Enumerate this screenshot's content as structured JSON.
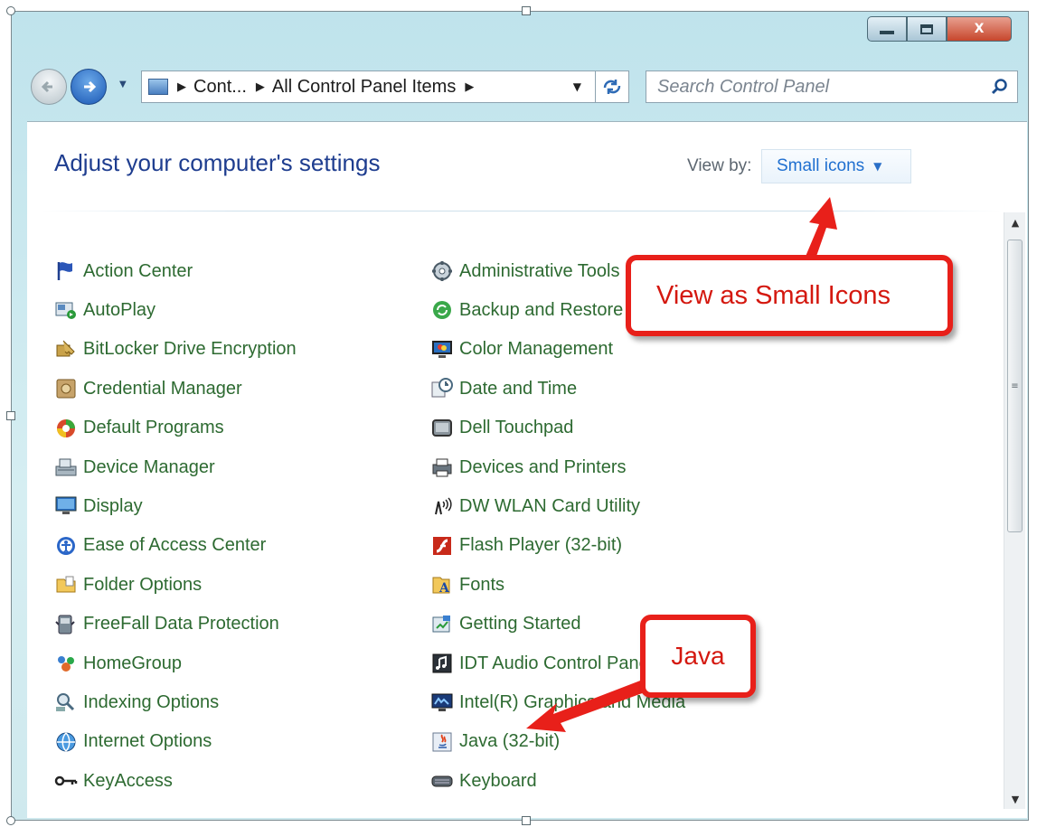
{
  "window": {
    "caption_buttons": {
      "minimize_icon": "minimize-icon",
      "maximize_icon": "maximize-icon",
      "close_glyph": "X"
    }
  },
  "address_bar": {
    "crumbs": [
      "Cont...",
      "All Control Panel Items"
    ],
    "search_placeholder": "Search Control Panel"
  },
  "header": {
    "title": "Adjust your computer's settings",
    "view_by_label": "View by:",
    "view_by_value": "Small icons"
  },
  "items_left": [
    {
      "label": "Action Center",
      "icon": "flag-icon"
    },
    {
      "label": "AutoPlay",
      "icon": "autoplay-icon"
    },
    {
      "label": "BitLocker Drive Encryption",
      "icon": "bitlocker-key-icon"
    },
    {
      "label": "Credential Manager",
      "icon": "vault-icon"
    },
    {
      "label": "Default Programs",
      "icon": "default-programs-icon"
    },
    {
      "label": "Device Manager",
      "icon": "device-manager-icon"
    },
    {
      "label": "Display",
      "icon": "monitor-icon"
    },
    {
      "label": "Ease of Access Center",
      "icon": "ease-of-access-icon"
    },
    {
      "label": "Folder Options",
      "icon": "folder-icon"
    },
    {
      "label": "FreeFall Data Protection",
      "icon": "freefall-icon"
    },
    {
      "label": "HomeGroup",
      "icon": "homegroup-icon"
    },
    {
      "label": "Indexing Options",
      "icon": "indexing-icon"
    },
    {
      "label": "Internet Options",
      "icon": "internet-icon"
    },
    {
      "label": "KeyAccess",
      "icon": "key-icon"
    }
  ],
  "items_right": [
    {
      "label": "Administrative Tools",
      "icon": "admin-tools-icon"
    },
    {
      "label": "Backup and Restore",
      "icon": "backup-icon"
    },
    {
      "label": "Color Management",
      "icon": "color-monitor-icon"
    },
    {
      "label": "Date and Time",
      "icon": "clock-icon"
    },
    {
      "label": "Dell Touchpad",
      "icon": "touchpad-icon"
    },
    {
      "label": "Devices and Printers",
      "icon": "printer-icon"
    },
    {
      "label": "DW WLAN Card Utility",
      "icon": "wlan-icon"
    },
    {
      "label": "Flash Player (32-bit)",
      "icon": "flash-icon"
    },
    {
      "label": "Fonts",
      "icon": "fonts-icon"
    },
    {
      "label": "Getting Started",
      "icon": "getting-started-icon"
    },
    {
      "label": "IDT Audio Control Panel",
      "icon": "audio-icon"
    },
    {
      "label": "Intel(R) Graphics and Media",
      "icon": "intel-graphics-icon"
    },
    {
      "label": "Java (32-bit)",
      "icon": "java-icon"
    },
    {
      "label": "Keyboard",
      "icon": "keyboard-icon"
    }
  ],
  "callouts": {
    "small_icons": "View as Small Icons",
    "java": "Java"
  },
  "colors": {
    "link_green": "#2d6a31",
    "title_blue": "#1e3d8f",
    "callout_red": "#e8201a"
  }
}
